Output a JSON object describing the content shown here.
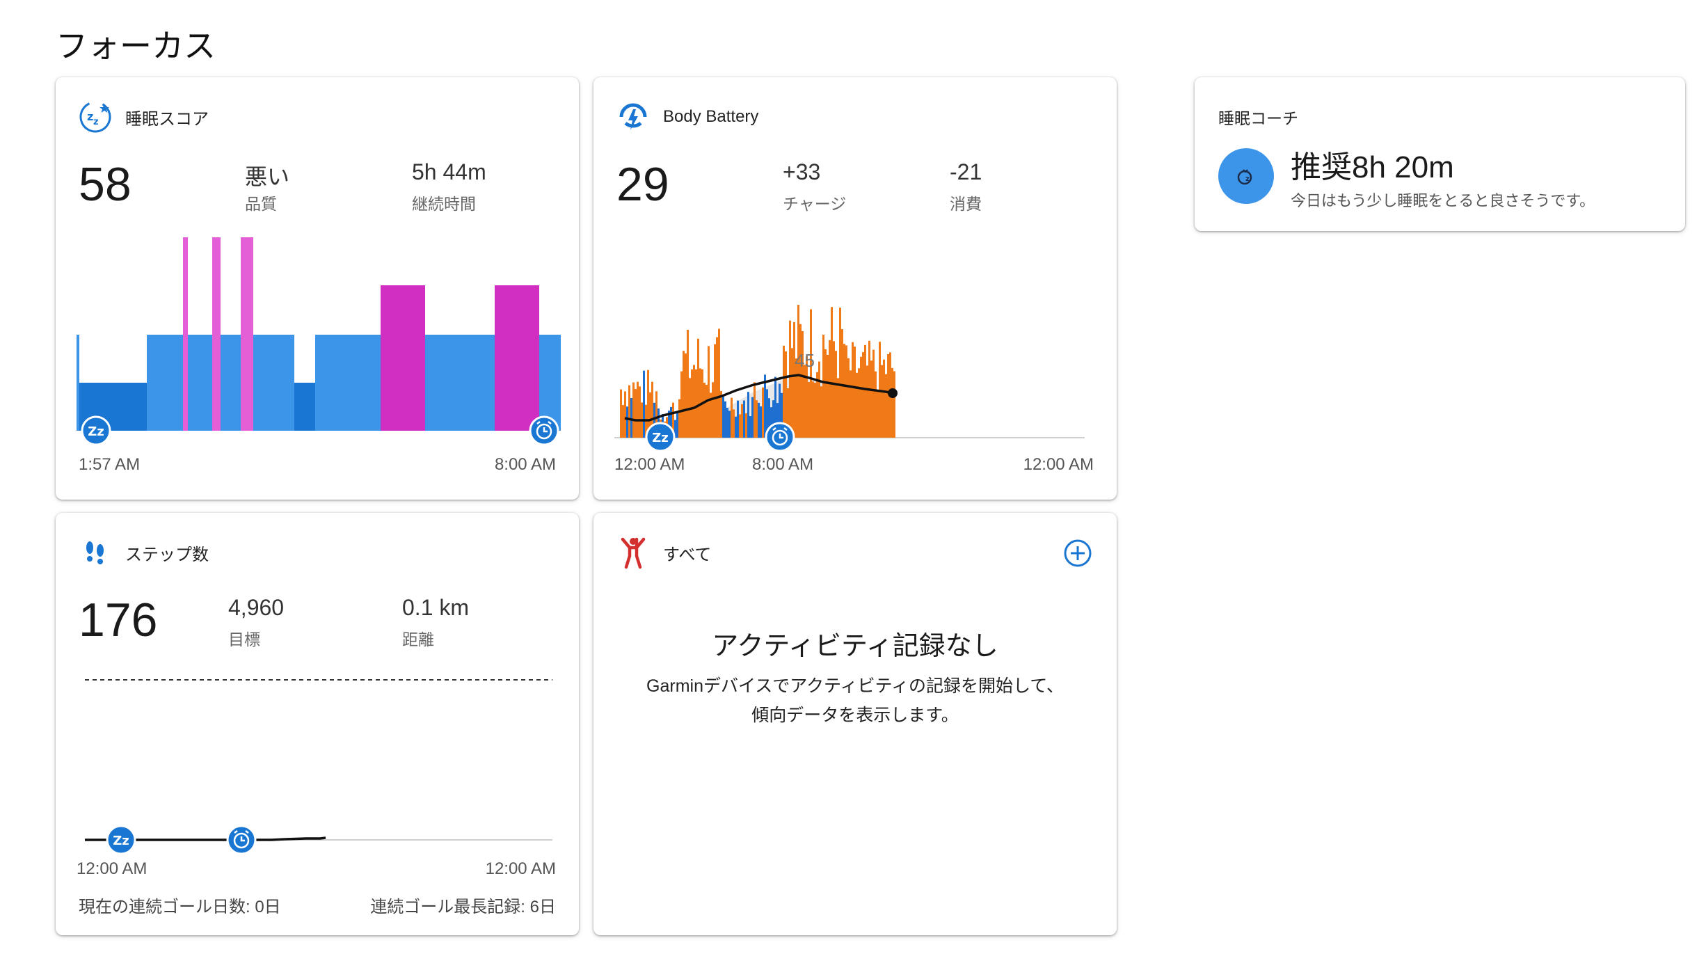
{
  "page": {
    "title": "フォーカス"
  },
  "sleep": {
    "label": "睡眠スコア",
    "score": "58",
    "quality_value": "悪い",
    "quality_label": "品質",
    "duration_value": "5h 44m",
    "duration_label": "継続時間",
    "x_start": "1:57 AM",
    "x_end": "8:00 AM",
    "icon": "sleep-score-icon",
    "colors": {
      "deep": "#1976d2",
      "light": "#3d95ea",
      "rem": "#d12fc2",
      "awake": "#e45fd5"
    }
  },
  "body_battery": {
    "label": "Body Battery",
    "value": "29",
    "charge_value": "+33",
    "charge_label": "チャージ",
    "drain_value": "-21",
    "drain_label": "消費",
    "peak_label": "45",
    "x_start": "12:00 AM",
    "x_mid": "8:00 AM",
    "x_end": "12:00 AM",
    "icon": "body-battery-icon",
    "colors": {
      "stress": "#f07a17",
      "rest": "#1e6fd0",
      "level": "#111111"
    }
  },
  "steps": {
    "label": "ステップ数",
    "value": "176",
    "goal_value": "4,960",
    "goal_label": "目標",
    "distance_value": "0.1 km",
    "distance_label": "距離",
    "x_start": "12:00 AM",
    "x_end": "12:00 AM",
    "streak_current": "現在の連続ゴール日数: 0日",
    "streak_best": "連続ゴール最長記録: 6日",
    "icon": "footsteps-icon"
  },
  "activities": {
    "label": "すべて",
    "empty_title": "アクティビティ記録なし",
    "empty_body": "Garminデバイスでアクティビティの記録を開始して、傾向データを表示します。",
    "icon": "activity-person-icon",
    "add_icon": "add-circle-icon"
  },
  "sleep_coach": {
    "label": "睡眠コーチ",
    "recommend_prefix": "推奨",
    "recommend_value": "8h 20m",
    "message": "今日はもう少し睡眠をとると良さそうです。",
    "icon": "sleep-coach-icon"
  }
}
